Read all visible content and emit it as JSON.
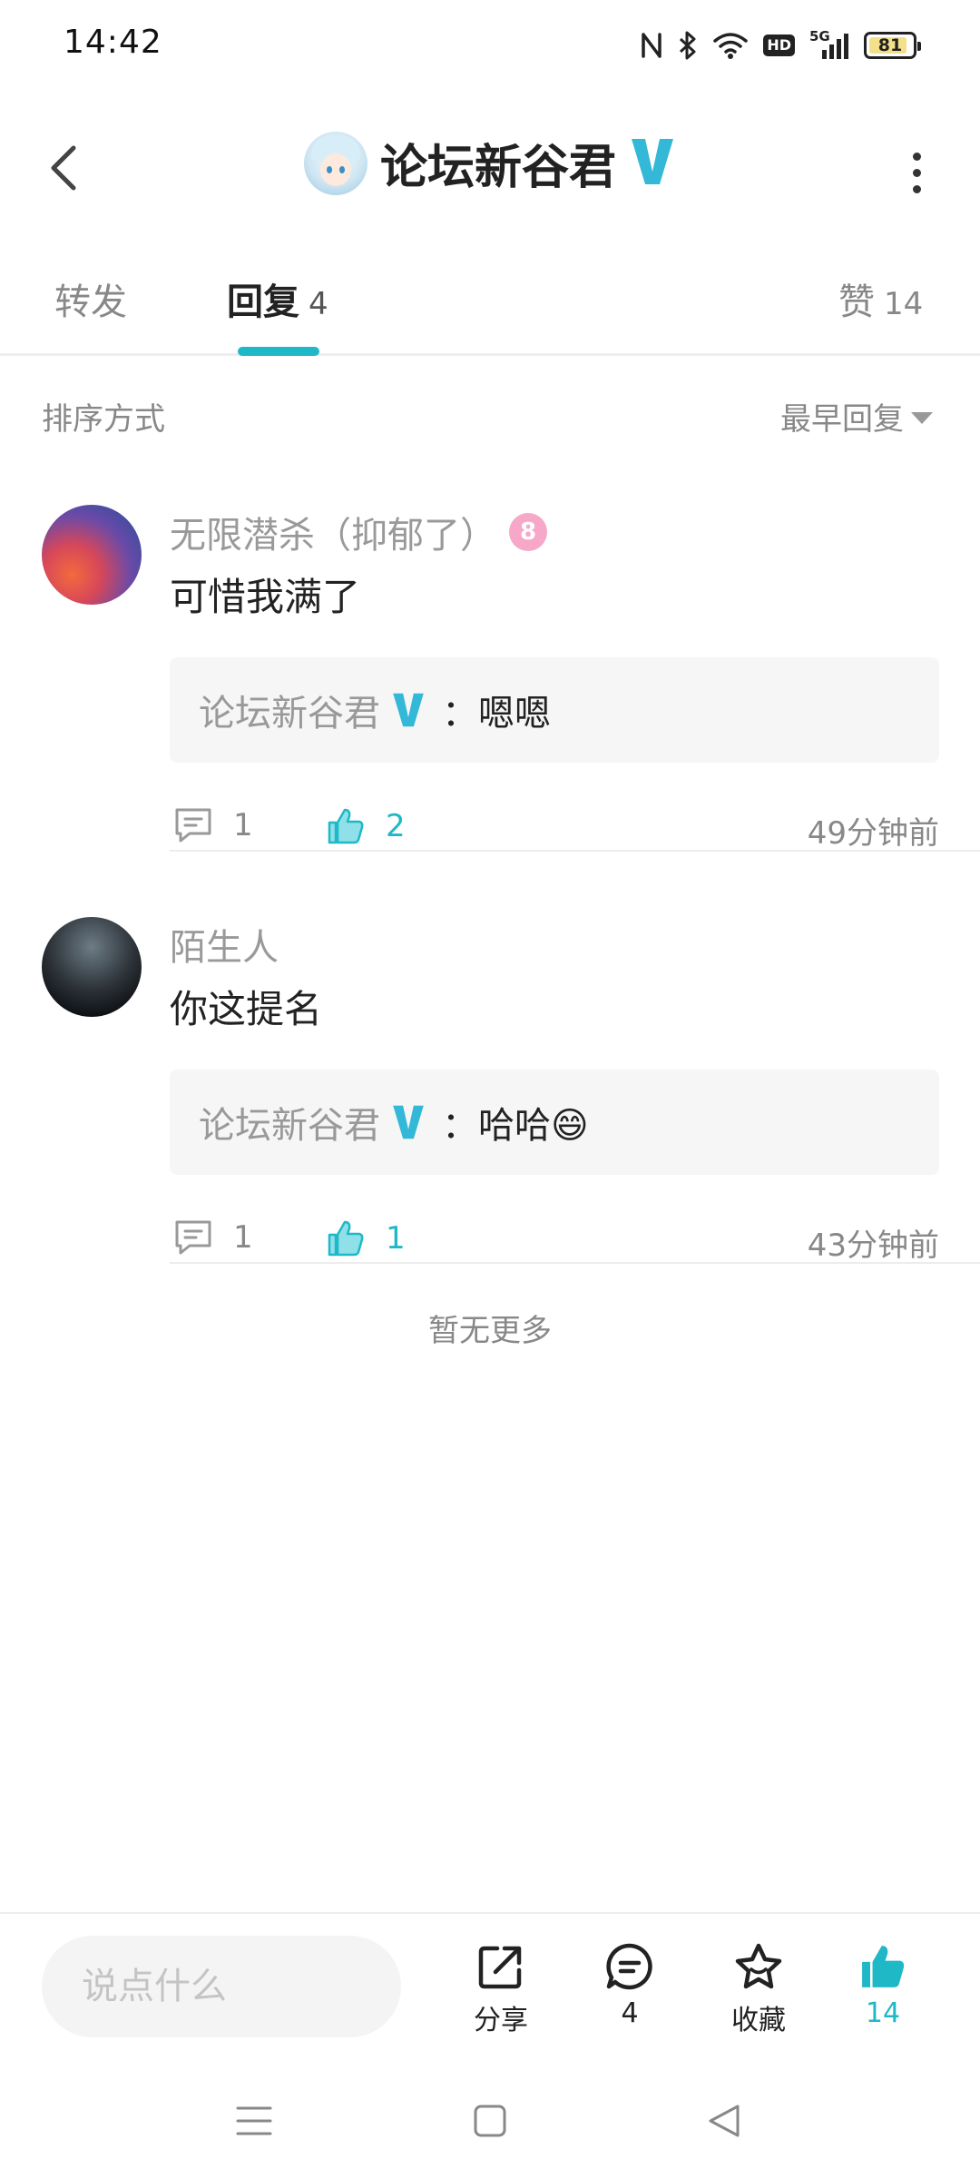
{
  "status_bar": {
    "time": "14:42",
    "network": "5G",
    "hd_label": "HD",
    "battery": "81"
  },
  "header": {
    "title": "论坛新谷君",
    "avatar_icon": "anime-avatar-icon",
    "verified_icon": "verified-v-icon",
    "accent_color": "#34b8d8"
  },
  "tabs": {
    "items": [
      {
        "label": "转发",
        "count": ""
      },
      {
        "label": "回复",
        "count": "4"
      },
      {
        "label": "赞",
        "count": "14"
      }
    ],
    "active_index": 1,
    "indicator_color": "#1fb8c7"
  },
  "sort": {
    "label": "排序方式",
    "selected": "最早回复"
  },
  "comments": [
    {
      "username": "无限潜杀（抑郁了）",
      "level_badge": "8",
      "text": "可惜我满了",
      "quote_author": "论坛新谷君",
      "quote_text": "：嗯嗯",
      "reply_count": "1",
      "like_count": "2",
      "time": "49分钟前"
    },
    {
      "username": "陌生人",
      "text": "你这提名",
      "quote_author": "论坛新谷君",
      "quote_text": "：哈哈😄",
      "reply_count": "1",
      "like_count": "1",
      "time": "43分钟前"
    }
  ],
  "no_more_text": "暂无更多",
  "bottom_bar": {
    "input_placeholder": "说点什么",
    "share_label": "分享",
    "comment_count": "4",
    "favorite_label": "收藏",
    "like_count": "14"
  }
}
